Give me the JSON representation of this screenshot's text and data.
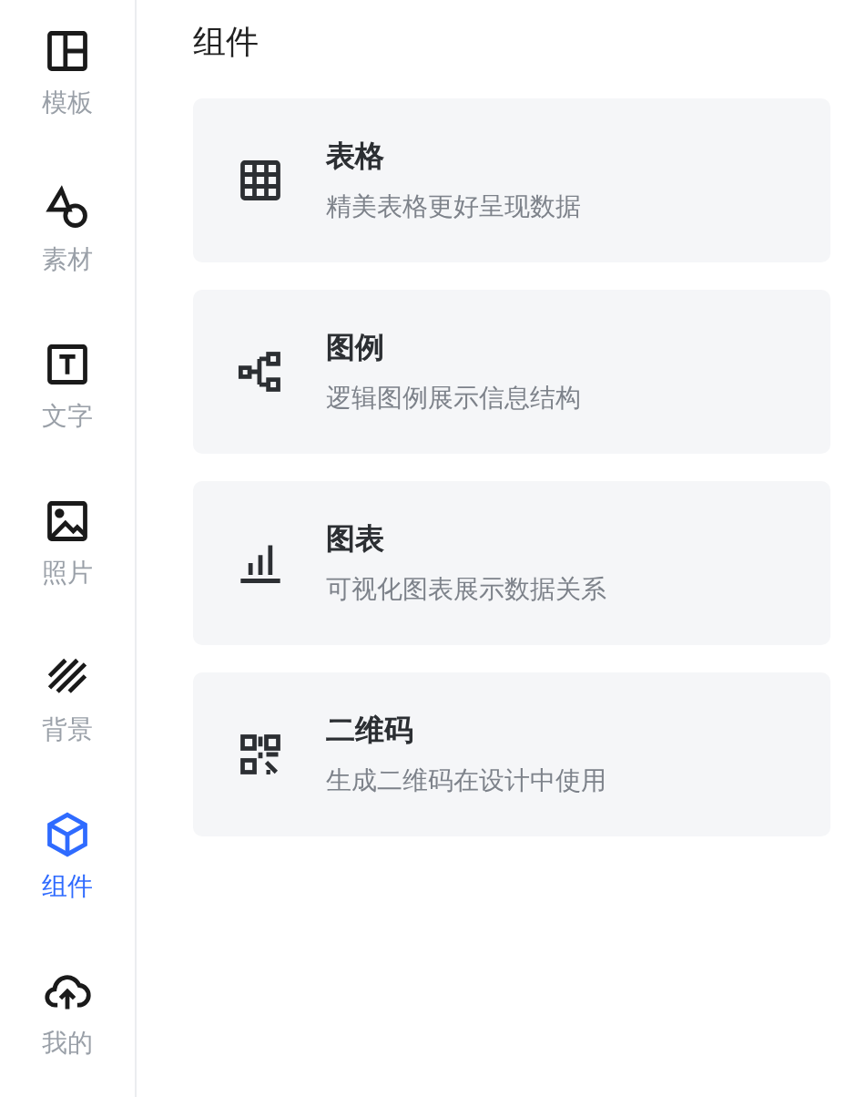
{
  "sidebar": {
    "items": [
      {
        "kind": "layout",
        "label": "模板",
        "selected": false
      },
      {
        "kind": "shapes",
        "label": "素材",
        "selected": false
      },
      {
        "kind": "text",
        "label": "文字",
        "selected": false
      },
      {
        "kind": "image",
        "label": "照片",
        "selected": false
      },
      {
        "kind": "stripes",
        "label": "背景",
        "selected": false
      },
      {
        "kind": "cube",
        "label": "组件",
        "selected": true
      },
      {
        "kind": "upload",
        "label": "我的",
        "selected": false
      }
    ]
  },
  "panel": {
    "title": "组件",
    "cards": [
      {
        "kind": "table",
        "title": "表格",
        "description": "精美表格更好呈现数据"
      },
      {
        "kind": "diagram",
        "title": "图例",
        "description": "逻辑图例展示信息结构"
      },
      {
        "kind": "chart",
        "title": "图表",
        "description": "可视化图表展示数据关系"
      },
      {
        "kind": "qrcode",
        "title": "二维码",
        "description": "生成二维码在设计中使用"
      }
    ]
  }
}
